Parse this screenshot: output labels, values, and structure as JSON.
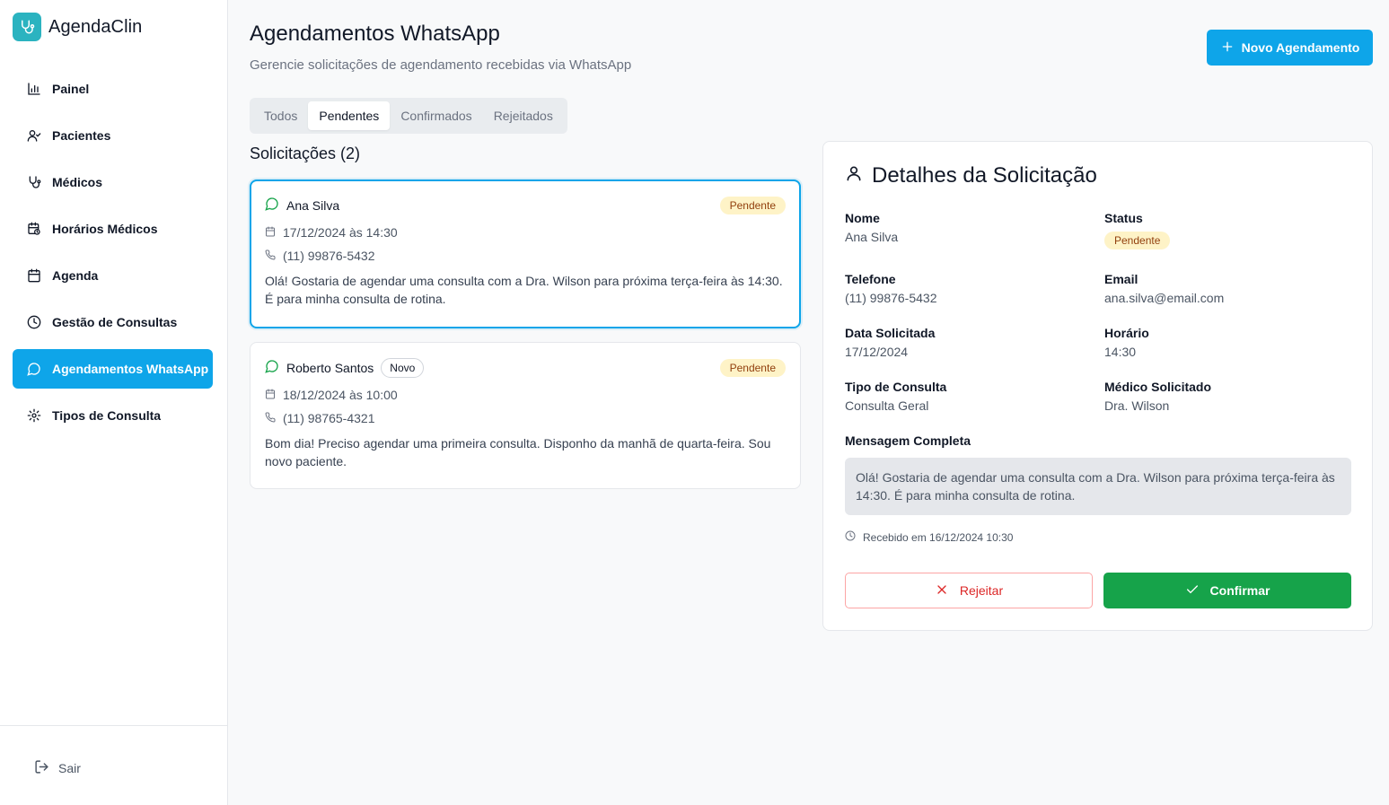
{
  "app": {
    "name": "AgendaClin"
  },
  "sidebar": {
    "items": [
      {
        "label": "Painel",
        "icon": "bar-chart-icon"
      },
      {
        "label": "Pacientes",
        "icon": "user-check-icon"
      },
      {
        "label": "Médicos",
        "icon": "stethoscope-icon"
      },
      {
        "label": "Horários Médicos",
        "icon": "calendar-clock-icon"
      },
      {
        "label": "Agenda",
        "icon": "calendar-icon"
      },
      {
        "label": "Gestão de Consultas",
        "icon": "clock-icon"
      },
      {
        "label": "Agendamentos WhatsApp",
        "icon": "message-circle-icon",
        "active": true
      },
      {
        "label": "Tipos de Consulta",
        "icon": "gear-icon"
      }
    ],
    "logout_label": "Sair"
  },
  "header": {
    "title": "Agendamentos WhatsApp",
    "subtitle": "Gerencie solicitações de agendamento recebidas via WhatsApp",
    "new_button_label": "Novo Agendamento"
  },
  "tabs": [
    {
      "label": "Todos"
    },
    {
      "label": "Pendentes",
      "active": true
    },
    {
      "label": "Confirmados"
    },
    {
      "label": "Rejeitados"
    }
  ],
  "requests": {
    "title": "Solicitações (2)",
    "items": [
      {
        "name": "Ana Silva",
        "status": "Pendente",
        "datetime": "17/12/2024 às 14:30",
        "phone": "(11) 99876-5432",
        "message": "Olá! Gostaria de agendar uma consulta com a Dra. Wilson para próxima terça-feira às 14:30. É para minha consulta de rotina."
      },
      {
        "name": "Roberto Santos",
        "badge": "Novo",
        "status": "Pendente",
        "datetime": "18/12/2024 às 10:00",
        "phone": "(11) 98765-4321",
        "message": "Bom dia! Preciso agendar uma primeira consulta. Disponho da manhã de quarta-feira. Sou novo paciente."
      }
    ]
  },
  "details": {
    "title": "Detalhes da Solicitação",
    "nome_label": "Nome",
    "nome_value": "Ana Silva",
    "status_label": "Status",
    "status_value": "Pendente",
    "telefone_label": "Telefone",
    "telefone_value": "(11) 99876-5432",
    "email_label": "Email",
    "email_value": "ana.silva@email.com",
    "data_label": "Data Solicitada",
    "data_value": "17/12/2024",
    "horario_label": "Horário",
    "horario_value": "14:30",
    "tipo_label": "Tipo de Consulta",
    "tipo_value": "Consulta Geral",
    "medico_label": "Médico Solicitado",
    "medico_value": "Dra. Wilson",
    "mensagem_label": "Mensagem Completa",
    "mensagem_value": "Olá! Gostaria de agendar uma consulta com a Dra. Wilson para próxima terça-feira às 14:30. É para minha consulta de rotina.",
    "received": "Recebido em 16/12/2024 10:30",
    "reject_label": "Rejeitar",
    "confirm_label": "Confirmar"
  },
  "colors": {
    "accent": "#0ea5e9",
    "confirm": "#16a34a",
    "reject": "#dc2626",
    "pending_bg": "#fef3c7",
    "whatsapp_icon": "#16a34a"
  }
}
